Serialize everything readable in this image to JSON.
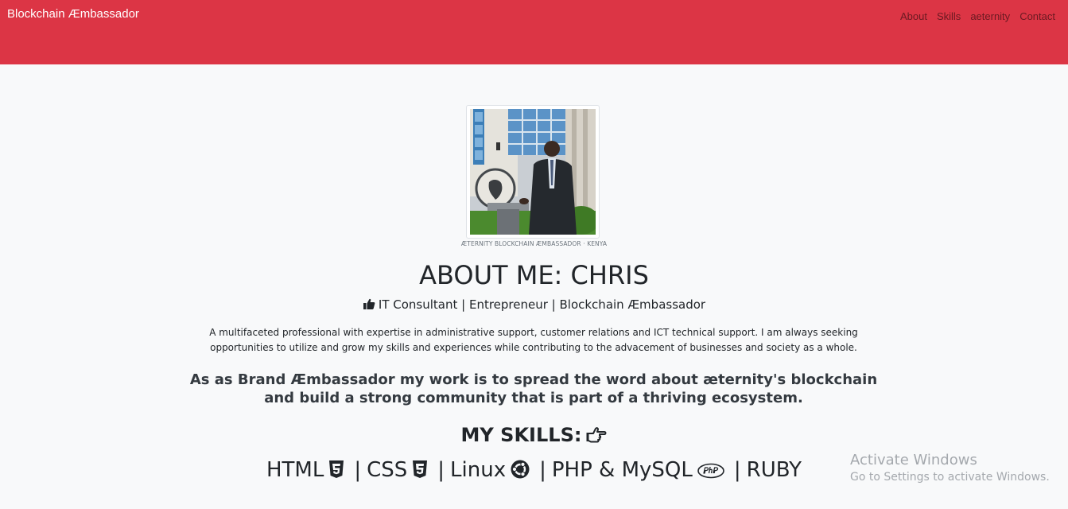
{
  "navbar": {
    "brand": "Blockchain Æmbassador",
    "links": [
      "About",
      "Skills",
      "aeternity",
      "Contact"
    ],
    "color": "#dc3545"
  },
  "profile": {
    "caption": "ÆTERNITY BLOCKCHAIN ÆMBASSADOR · KENYA"
  },
  "about": {
    "title": "ABOUT ME: CHRIS",
    "roles": "IT Consultant | Entrepreneur | Blockchain Æmbassador",
    "roles_icon": "thumbs-up-icon",
    "description": "A multifaceted professional with expertise in administrative support, customer relations and ICT technical support. I am always seeking opportunities to utilize and grow my skills and experiences while contributing to the advacement of businesses and society as a whole.",
    "mission": "As as Brand Æmbassador my work is to spread the word about æternity's blockchain and build a strong community that is part of a thriving ecosystem."
  },
  "skills": {
    "title": "MY SKILLS:",
    "title_icon": "hand-point-right-icon",
    "items": [
      {
        "label": "HTML",
        "icon": "html5-icon"
      },
      {
        "label": "CSS",
        "icon": "css3-icon"
      },
      {
        "label": "Linux",
        "icon": "ubuntu-icon"
      },
      {
        "label": "PHP & MySQL",
        "icon": "php-icon"
      },
      {
        "label": "RUBY",
        "icon": ""
      }
    ],
    "separator": "|"
  },
  "watermark": {
    "line1": "Activate Windows",
    "line2": "Go to Settings to activate Windows."
  }
}
